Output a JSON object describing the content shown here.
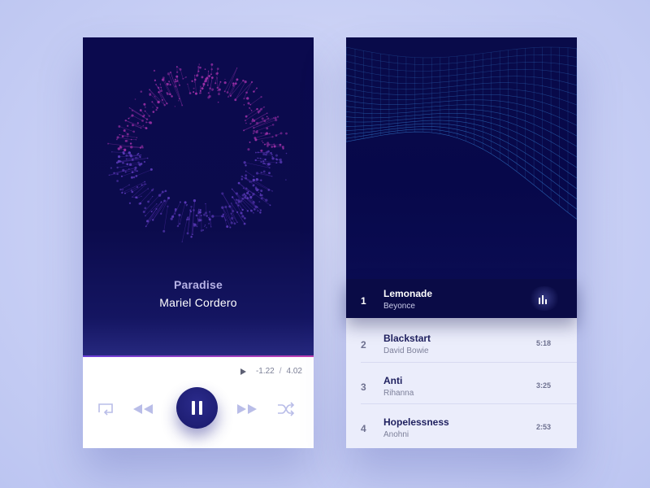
{
  "player": {
    "song_title": "Paradise",
    "song_artist": "Mariel Cordero",
    "elapsed": "-1.22",
    "separator": "/",
    "duration": "4.02",
    "progress": 1.0,
    "icons": [
      "repeat-icon",
      "rewind-icon",
      "pause-icon",
      "fast-forward-icon",
      "shuffle-icon",
      "play-icon"
    ]
  },
  "playlist": {
    "tracks": [
      {
        "number": "1",
        "title": "Lemonade",
        "artist": "Beyonce",
        "duration": "",
        "playing": true
      },
      {
        "number": "2",
        "title": "Blackstart",
        "artist": "David Bowie",
        "duration": "5:18",
        "playing": false
      },
      {
        "number": "3",
        "title": "Anti",
        "artist": "Rihanna",
        "duration": "3:25",
        "playing": false
      },
      {
        "number": "4",
        "title": "Hopelessness",
        "artist": "Anohni",
        "duration": "2:53",
        "playing": false
      }
    ]
  },
  "colors": {
    "background": "#c9d0f5",
    "dark_navy": "#0b0a4e",
    "accent_purple": "#6a3fd8",
    "accent_pink": "#c23fb0",
    "icon_light": "#b9bde8"
  }
}
